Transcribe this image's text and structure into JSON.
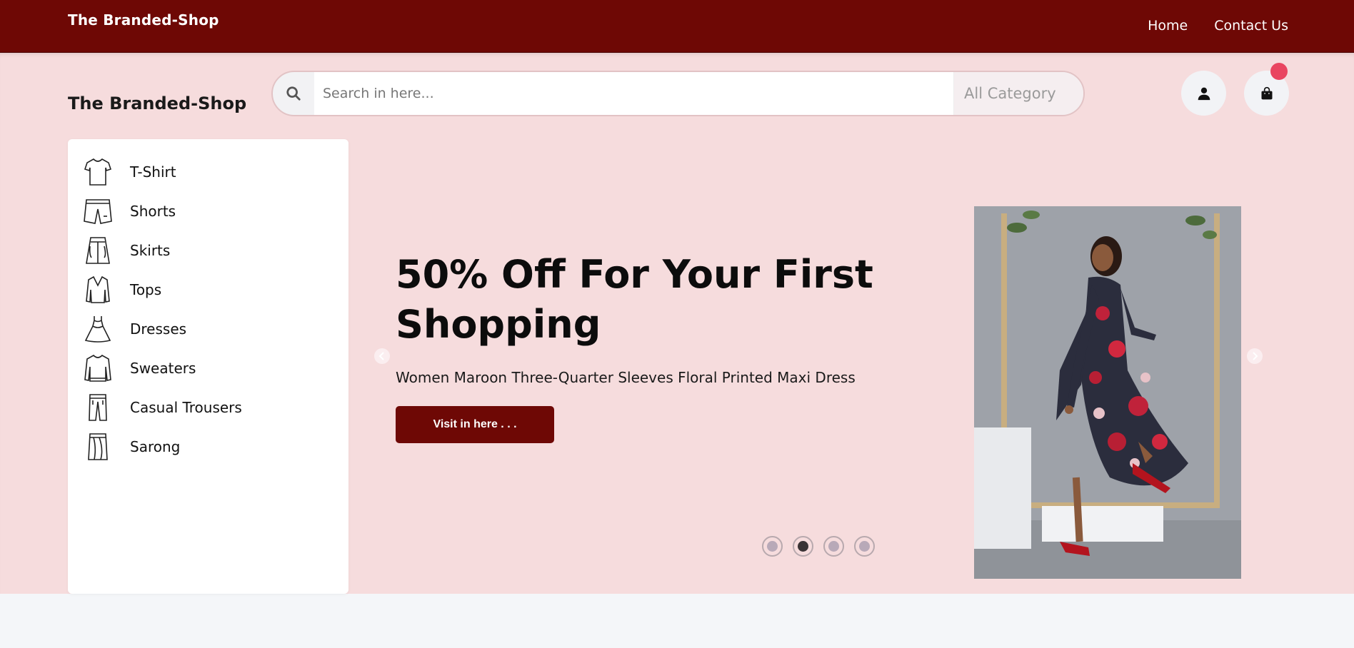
{
  "colors": {
    "brand": "#6e0805",
    "hero_bg": "#f6dcdd",
    "badge": "#e94560"
  },
  "topbar": {
    "brand": "The Branded-Shop",
    "nav": [
      {
        "label": "Home"
      },
      {
        "label": "Contact Us"
      }
    ]
  },
  "header": {
    "logo": "The Branded-Shop",
    "search": {
      "placeholder": "Search in here...",
      "value": "",
      "category": "All Category",
      "icon": "search-icon"
    },
    "user_icon": "user-icon",
    "cart_icon": "shopping-bag-icon"
  },
  "sidebar": {
    "categories": [
      {
        "label": "T-Shirt",
        "icon": "tshirt-icon"
      },
      {
        "label": "Shorts",
        "icon": "shorts-icon"
      },
      {
        "label": "Skirts",
        "icon": "skirt-icon"
      },
      {
        "label": "Tops",
        "icon": "top-icon"
      },
      {
        "label": "Dresses",
        "icon": "dress-icon"
      },
      {
        "label": "Sweaters",
        "icon": "sweater-icon"
      },
      {
        "label": "Casual Trousers",
        "icon": "trousers-icon"
      },
      {
        "label": "Sarong",
        "icon": "sarong-icon"
      }
    ]
  },
  "hero": {
    "title": "50% Off For Your First Shopping",
    "subtitle": "Women Maroon Three-Quarter Sleeves Floral Printed Maxi Dress",
    "button": "Visit in here . . .",
    "slides_total": 4,
    "active_slide": 2
  }
}
